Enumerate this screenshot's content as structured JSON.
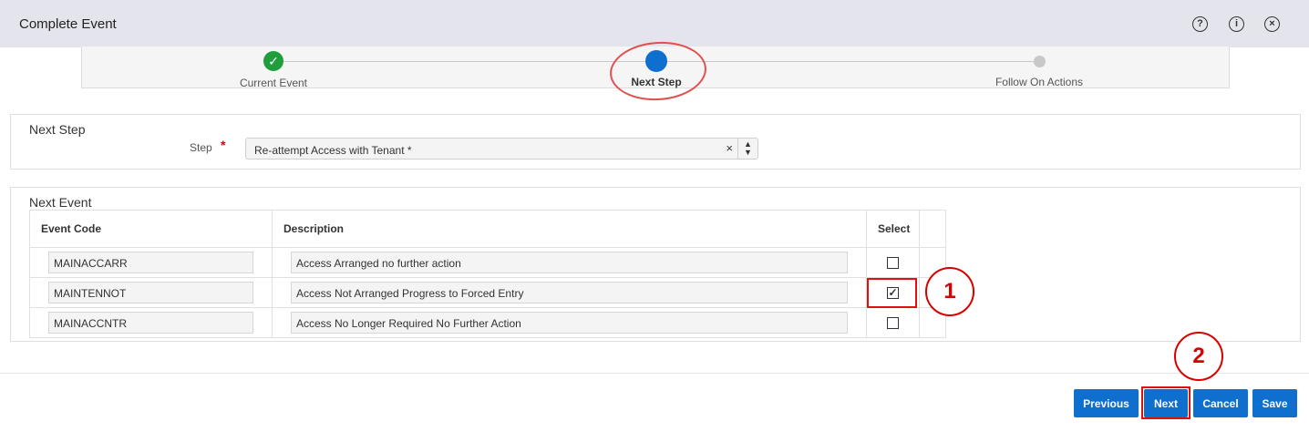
{
  "window": {
    "title": "Complete Event",
    "icons": [
      "help-icon",
      "info-icon",
      "close-icon"
    ],
    "icon_glyphs": {
      "help": "?",
      "info": "i",
      "close": "×"
    }
  },
  "train": {
    "stops": [
      {
        "label": "Current Event",
        "state": "done",
        "glyph": "✓"
      },
      {
        "label": "Next Step",
        "state": "current"
      },
      {
        "label": "Follow On Actions",
        "state": "future"
      }
    ]
  },
  "next_step": {
    "panel_title": "Next Step",
    "step_label": "Step",
    "required_marker": "*",
    "step_value": "Re-attempt Access with Tenant *",
    "clear_glyph": "×",
    "spin_glyph_up": "▲",
    "spin_glyph_down": "▼"
  },
  "next_event": {
    "panel_title": "Next Event",
    "columns": {
      "code": "Event Code",
      "description": "Description",
      "select": "Select"
    },
    "rows": [
      {
        "code": "MAINACCARR",
        "description": "Access Arranged no further action",
        "selected": false,
        "check": ""
      },
      {
        "code": "MAINTENNOT",
        "description": "Access Not Arranged Progress to Forced Entry",
        "selected": true,
        "check": "✓"
      },
      {
        "code": "MAINACCNTR",
        "description": "Access No Longer Required No Further Action",
        "selected": false,
        "check": ""
      }
    ]
  },
  "annotations": {
    "badge1": "1",
    "badge2": "2",
    "highlight_color": "#e01010"
  },
  "footer": {
    "previous": "Previous",
    "next": "Next",
    "cancel": "Cancel",
    "save": "Save"
  },
  "colors": {
    "accent": "#0f6fcf",
    "success": "#1f9e3b",
    "titlebar": "#e4e4ec"
  }
}
